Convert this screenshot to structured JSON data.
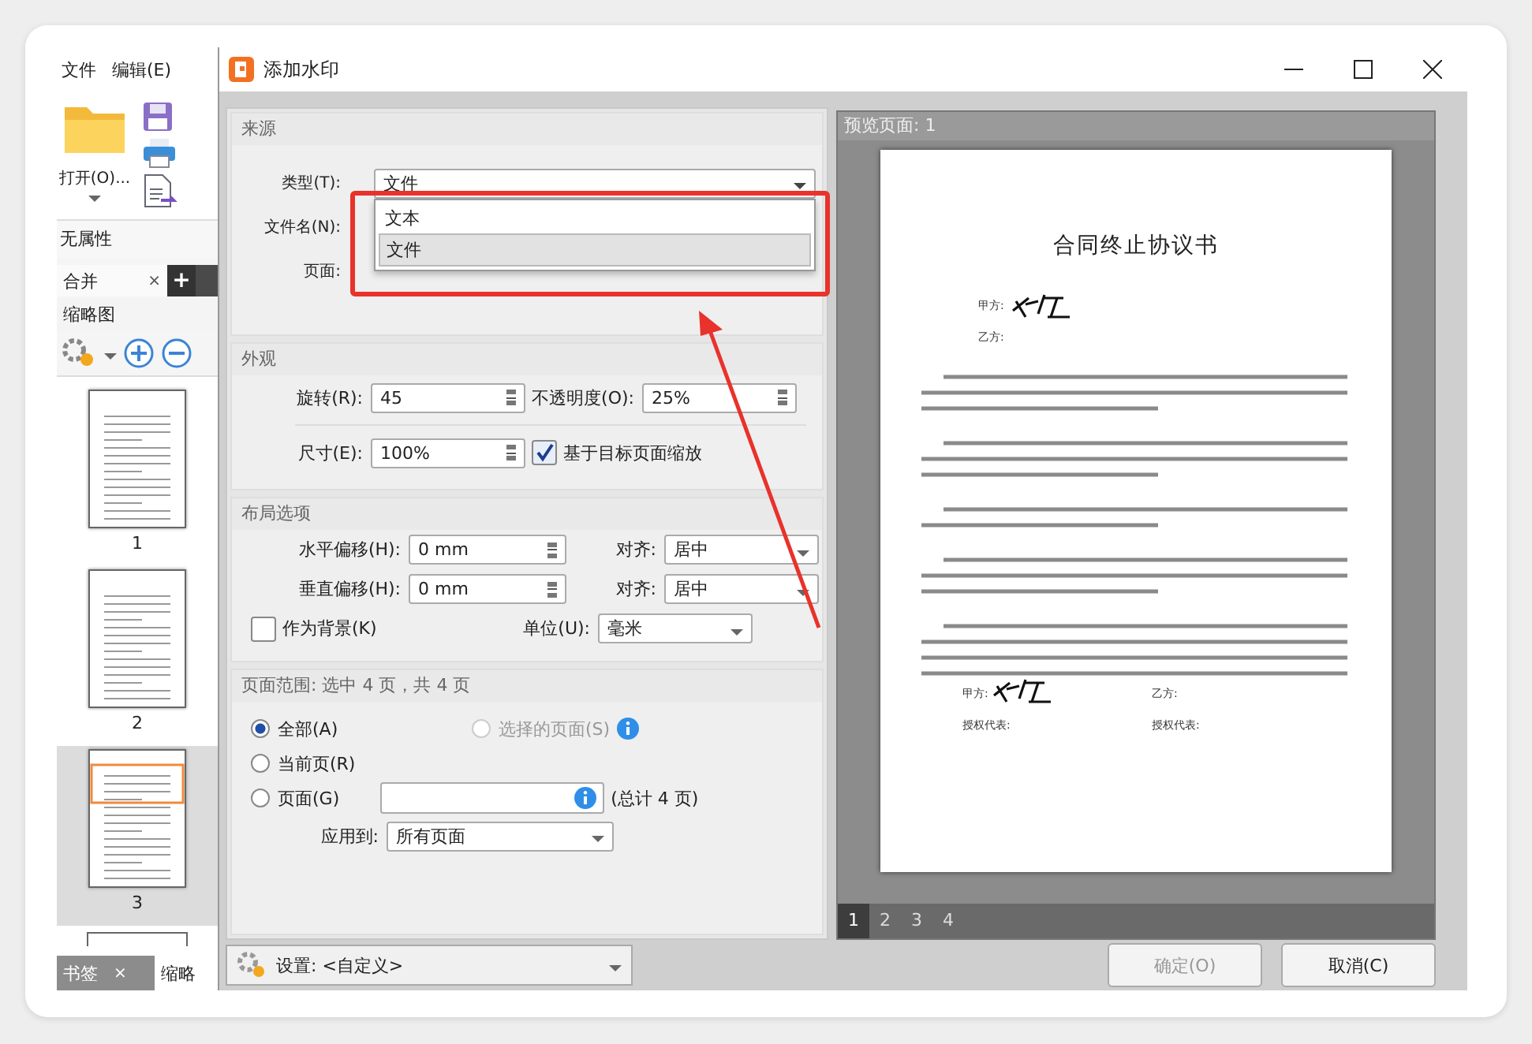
{
  "app": {
    "menu": [
      "文件",
      "编辑(E)"
    ],
    "open_label": "打开(O)...",
    "properties_label": "无属性",
    "doc_tabs": [
      {
        "label": "合并",
        "close": "×"
      }
    ],
    "add_tab": "+",
    "panel_title": "缩略图",
    "thumbnails": [
      {
        "label": "1",
        "selected": false
      },
      {
        "label": "2",
        "selected": false
      },
      {
        "label": "3",
        "selected": true
      }
    ],
    "bottom_tabs": [
      {
        "label": "书签",
        "close": "×",
        "selected": false
      },
      {
        "label": "缩略",
        "selected": true
      }
    ]
  },
  "dialog": {
    "title": "添加水印",
    "source": {
      "title": "来源",
      "type_label": "类型(T):",
      "type_value": "文件",
      "filename_label": "文件名(N):",
      "page_label": "页面:",
      "dropdown_options": [
        {
          "label": "文本",
          "selected": false
        },
        {
          "label": "文件",
          "selected": true
        }
      ]
    },
    "appearance": {
      "title": "外观",
      "rotation_label": "旋转(R):",
      "rotation_value": "45",
      "opacity_label": "不透明度(O):",
      "opacity_value": "25%",
      "size_label": "尺寸(E):",
      "size_value": "100%",
      "scale_label": "基于目标页面缩放",
      "scale_checked": true
    },
    "layout": {
      "title": "布局选项",
      "h_offset_label": "水平偏移(H):",
      "h_offset_value": "0 mm",
      "h_align_label": "对齐:",
      "h_align_value": "居中",
      "v_offset_label": "垂直偏移(H):",
      "v_offset_value": "0 mm",
      "v_align_label": "对齐:",
      "v_align_value": "居中",
      "background_label": "作为背景(K)",
      "background_checked": false,
      "unit_label": "单位(U):",
      "unit_value": "毫米"
    },
    "page_range": {
      "title": "页面范围: 选中 4 页，共 4 页",
      "radios": [
        {
          "label": "全部(A)",
          "selected": true,
          "disabled": false
        },
        {
          "label": "选择的页面(S)",
          "selected": false,
          "disabled": true
        },
        {
          "label": "当前页(R)",
          "selected": false,
          "disabled": false
        },
        {
          "label": "页面(G)",
          "selected": false,
          "disabled": false
        }
      ],
      "total_label": "(总计 4 页)",
      "apply_label": "应用到:",
      "apply_value": "所有页面"
    },
    "settings": "设置: <自定义>",
    "buttons": [
      {
        "label": "确定(O)",
        "disabled": true
      },
      {
        "label": "取消(C)",
        "disabled": false
      }
    ],
    "preview": {
      "title": "预览页面: 1",
      "doc_title": "合同终止协议书",
      "party_a": "甲方:",
      "party_b": "乙方:",
      "footer": [
        "甲方:",
        "乙方:",
        "授权代表:",
        "授权代表:"
      ],
      "pages": [
        {
          "label": "1",
          "selected": true
        },
        {
          "label": "2",
          "selected": false
        },
        {
          "label": "3",
          "selected": false
        },
        {
          "label": "4",
          "selected": false
        }
      ]
    }
  }
}
